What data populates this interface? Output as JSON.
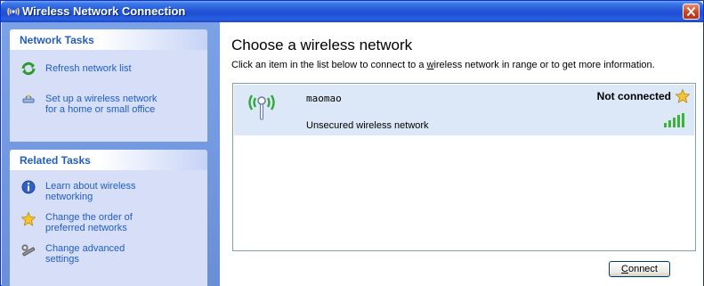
{
  "window": {
    "title": "Wireless Network Connection",
    "title_icon": "wireless-antenna-icon",
    "close_icon": "close-icon"
  },
  "sidebar": {
    "network_tasks": {
      "header": "Network Tasks",
      "items": [
        {
          "label": "Refresh network list",
          "icon": "refresh-icon"
        },
        {
          "label_line1": "Set up a wireless network",
          "label_line2": "for a home or small office",
          "icon": "setup-wizard-icon"
        }
      ]
    },
    "related_tasks": {
      "header": "Related Tasks",
      "items": [
        {
          "label_line1": "Learn about wireless",
          "label_line2": "networking",
          "icon": "info-icon"
        },
        {
          "label_line1": "Change the order of",
          "label_line2": "preferred networks",
          "icon": "star-icon"
        },
        {
          "label_line1": "Change advanced",
          "label_line2": "settings",
          "icon": "settings-icon"
        }
      ]
    }
  },
  "main": {
    "heading": "Choose a wireless network",
    "description_pre": "Click an item in the list below to connect to a ",
    "description_ul": "w",
    "description_post": "ireless network in range or to get more information.",
    "networks": [
      {
        "name": "maomao",
        "status": "Not connected",
        "security": "Unsecured wireless network",
        "signal_strength": 1.0,
        "selected": true
      }
    ],
    "connect_button": {
      "ul": "C",
      "rest": "onnect"
    }
  },
  "colors": {
    "titlebar": "#2456d8",
    "task_link": "#215dc6",
    "selected_row": "#dce7f7",
    "signal_bars": "#3bb33b"
  }
}
